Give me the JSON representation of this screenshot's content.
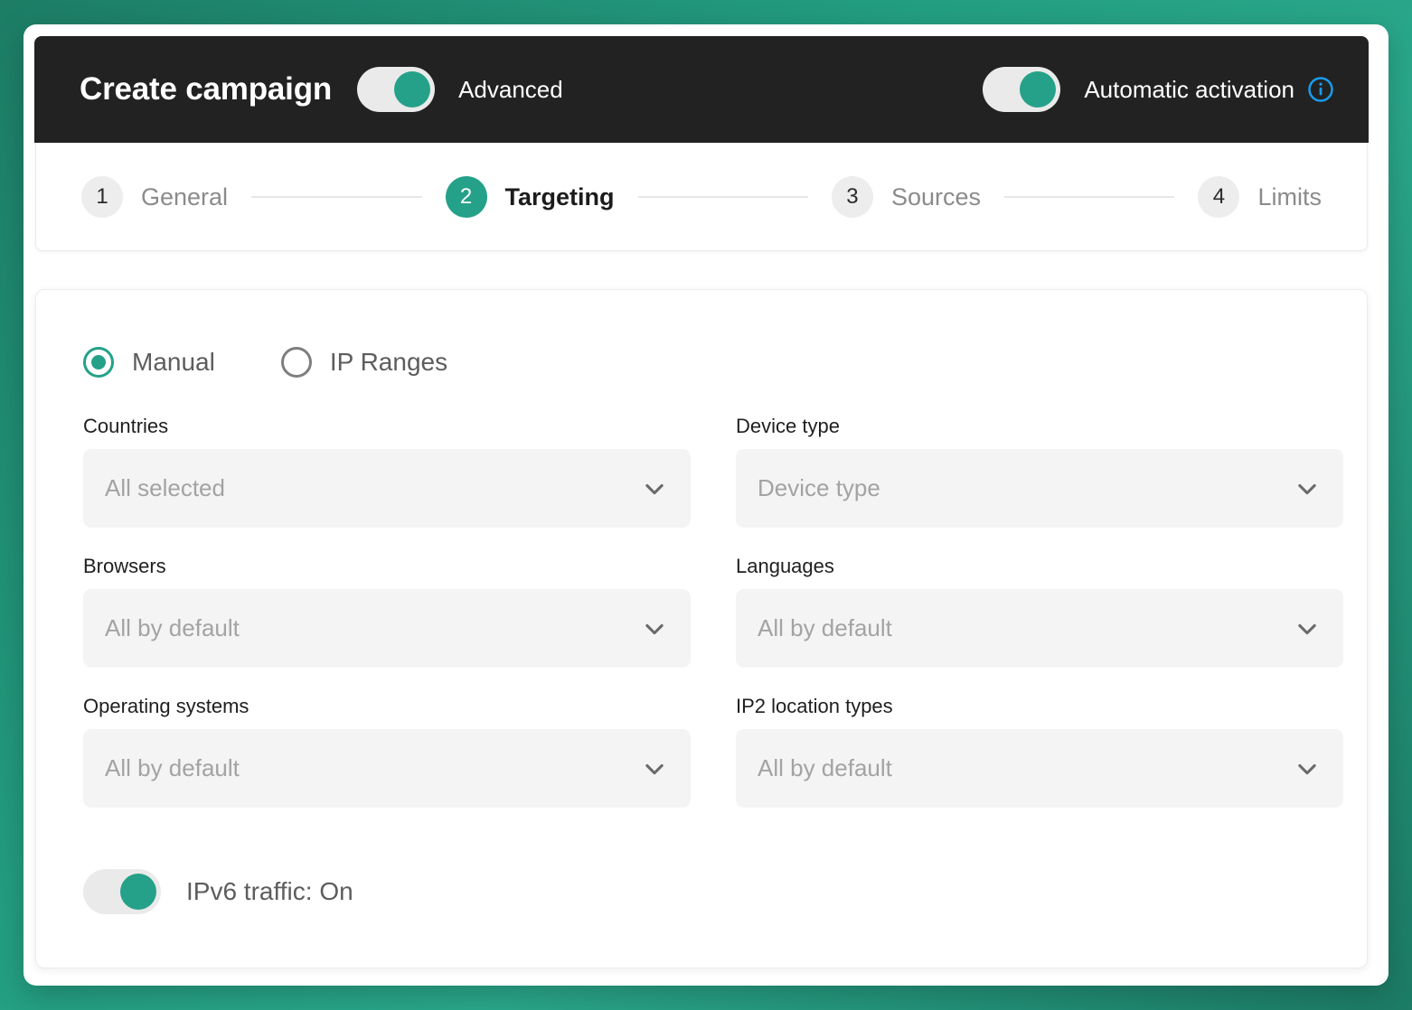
{
  "theme": {
    "accent": "#25a189",
    "page_background": "#239e81",
    "header_background": "#222222",
    "field_background": "#f4f4f4",
    "info_icon_color": "#1a9ced"
  },
  "header": {
    "title": "Create campaign",
    "advanced_toggle": {
      "label": "Advanced",
      "state": "on"
    },
    "automatic_activation_toggle": {
      "label": "Automatic activation",
      "state": "on"
    },
    "info_icon": "info-circle-icon",
    "info_icon_glyph": "i"
  },
  "stepper": {
    "steps": [
      {
        "number": "1",
        "label": "General",
        "active": false
      },
      {
        "number": "2",
        "label": "Targeting",
        "active": true
      },
      {
        "number": "3",
        "label": "Sources",
        "active": false
      },
      {
        "number": "4",
        "label": "Limits",
        "active": false
      }
    ]
  },
  "targeting": {
    "mode_options": [
      {
        "label": "Manual",
        "selected": true
      },
      {
        "label": "IP Ranges",
        "selected": false
      }
    ],
    "fields": [
      {
        "label": "Countries",
        "value": "All selected",
        "icon": "chevron-down-icon"
      },
      {
        "label": "Device type",
        "value": "Device type",
        "icon": "chevron-down-icon"
      },
      {
        "label": "Browsers",
        "value": "All by default",
        "icon": "chevron-down-icon"
      },
      {
        "label": "Languages",
        "value": "All by default",
        "icon": "chevron-down-icon"
      },
      {
        "label": "Operating systems",
        "value": "All by default",
        "icon": "chevron-down-icon"
      },
      {
        "label": "IP2 location types",
        "value": "All by default",
        "icon": "chevron-down-icon"
      }
    ],
    "ipv6": {
      "label": "IPv6 traffic: On",
      "state": "on"
    }
  }
}
